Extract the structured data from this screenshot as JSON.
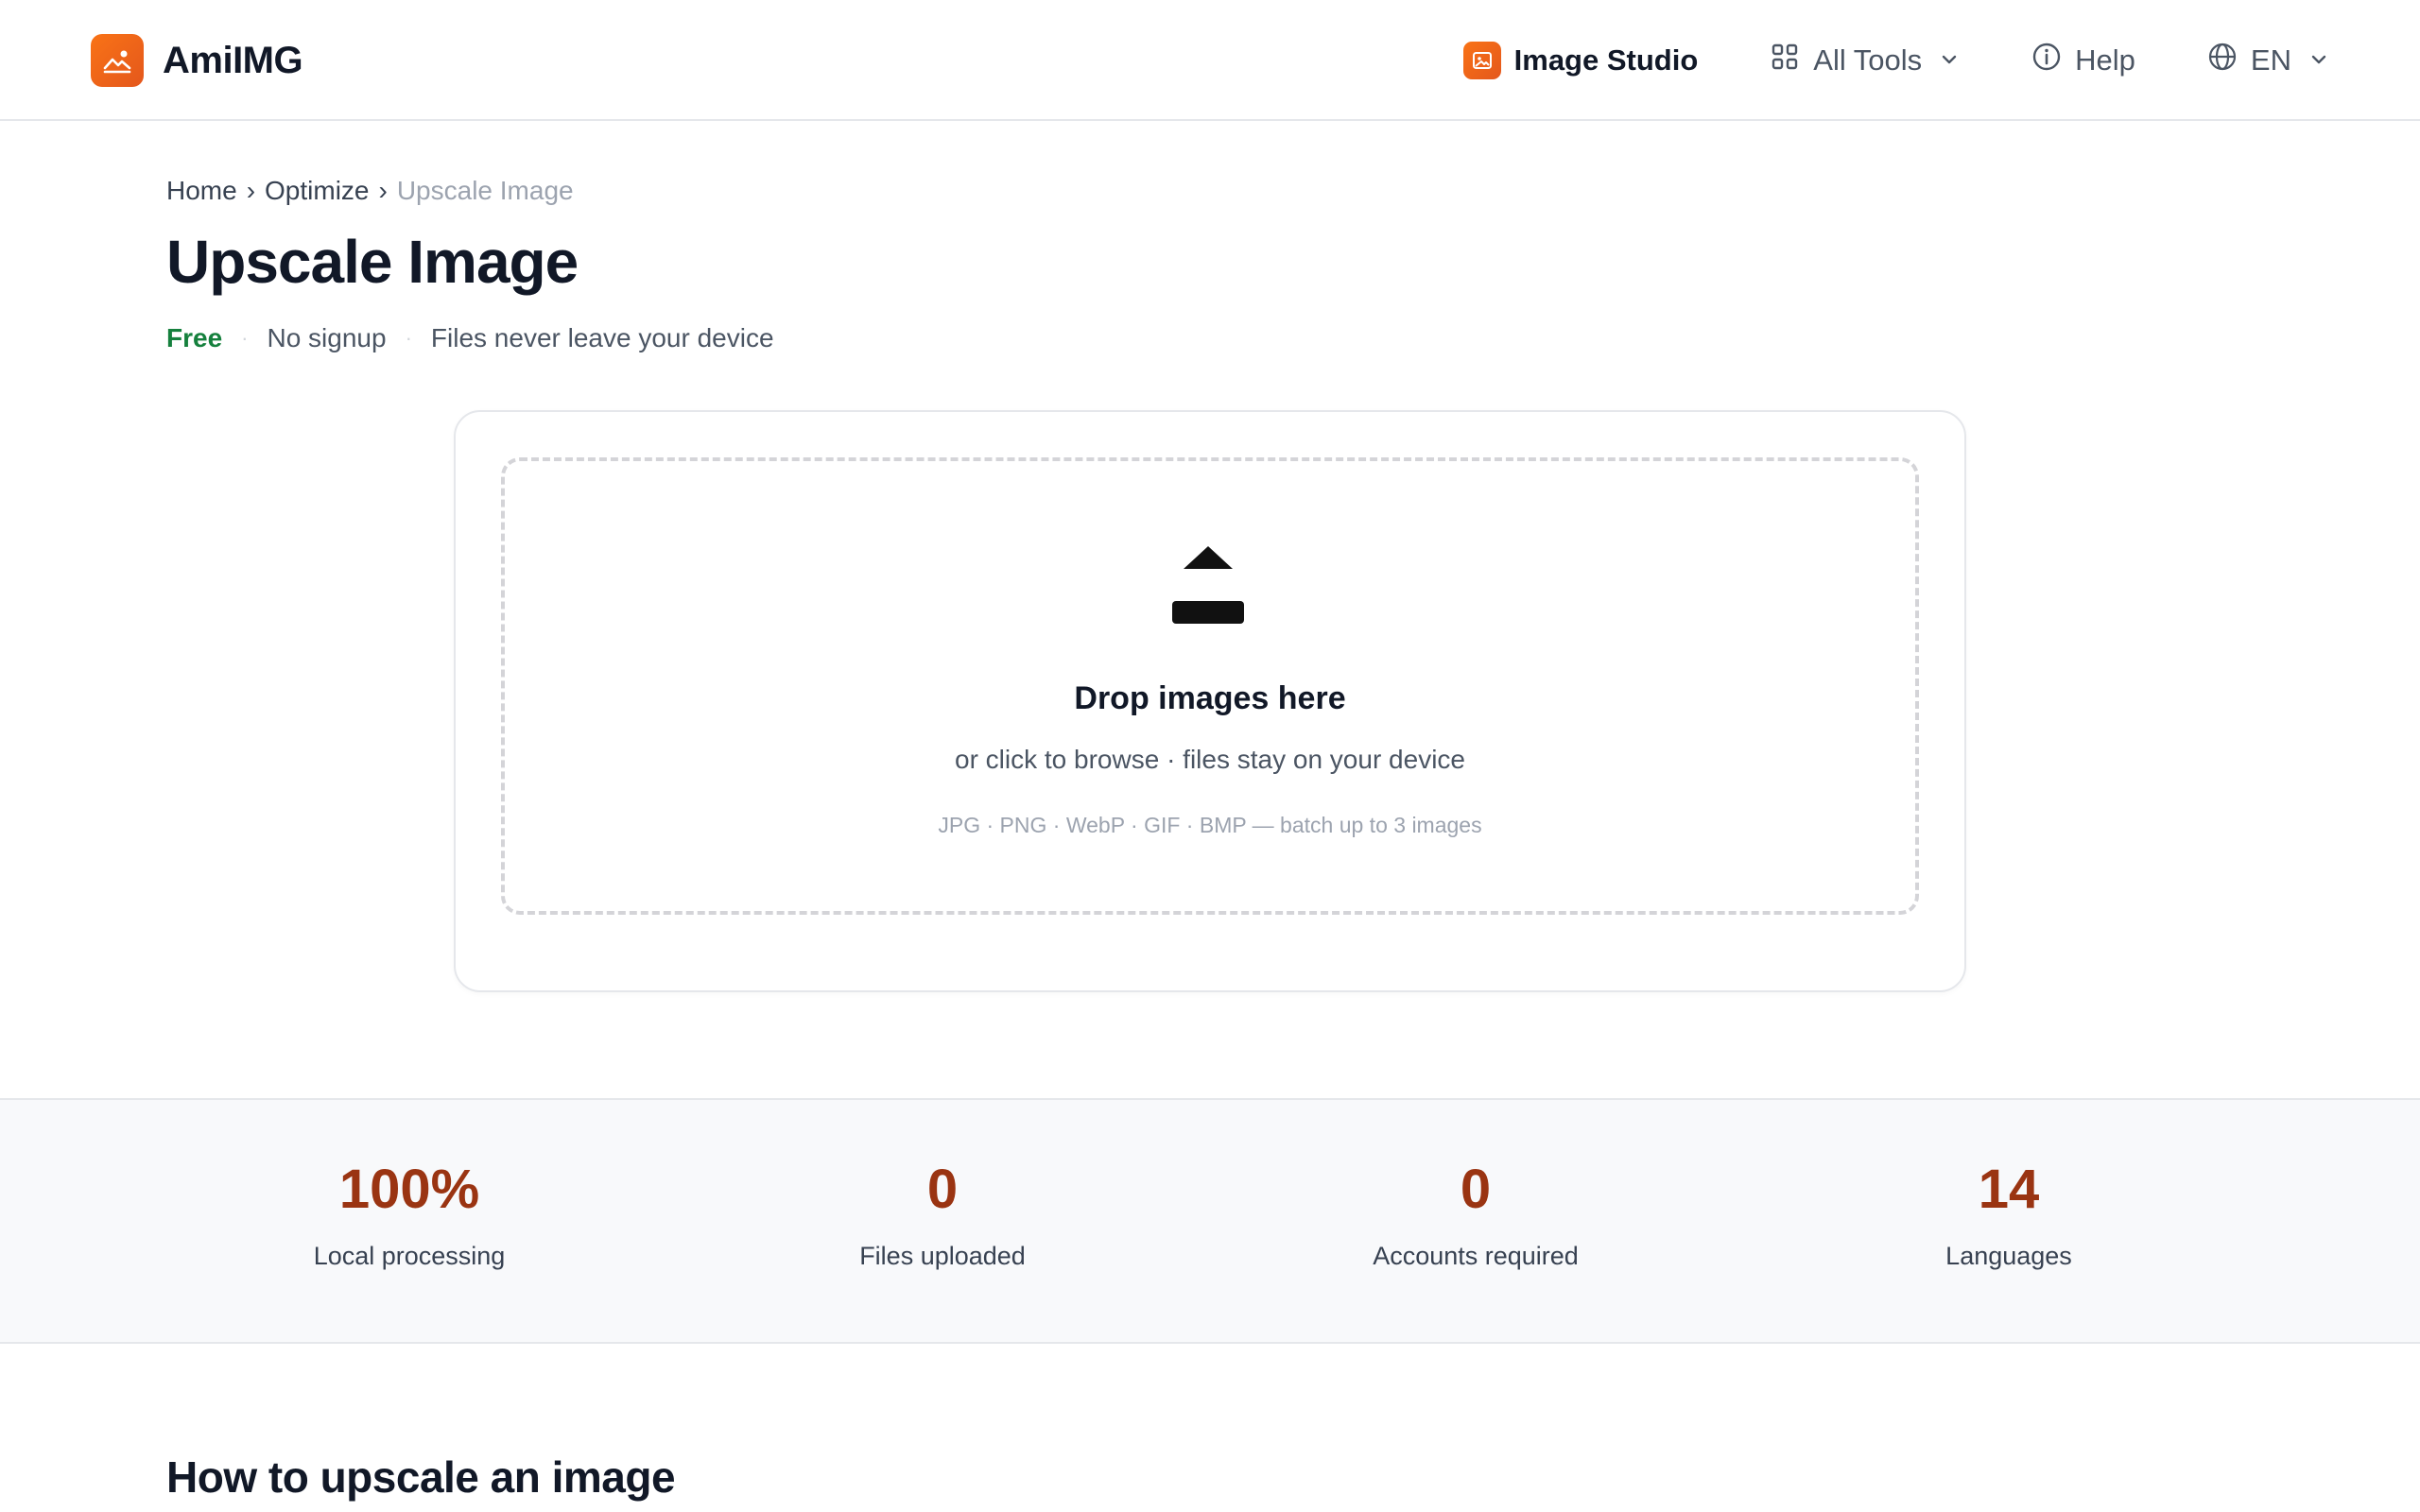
{
  "header": {
    "brand": "AmiIMG",
    "nav": {
      "studio": "Image Studio",
      "all_tools": "All Tools",
      "help": "Help",
      "lang": "EN"
    }
  },
  "breadcrumb": {
    "home": "Home",
    "sep": "›",
    "optimize": "Optimize",
    "current": "Upscale Image"
  },
  "page": {
    "title": "Upscale Image",
    "badges": {
      "free": "Free",
      "dot": "·",
      "no_signup": "No signup",
      "privacy": "Files never leave your device"
    }
  },
  "upload": {
    "title": "Drop images here",
    "subtitle": "or click to browse · files stay on your device",
    "formats": "JPG · PNG · WebP · GIF · BMP — batch up to 3 images"
  },
  "stats": [
    {
      "value": "100%",
      "label": "Local processing"
    },
    {
      "value": "0",
      "label": "Files uploaded"
    },
    {
      "value": "0",
      "label": "Accounts required"
    },
    {
      "value": "14",
      "label": "Languages"
    }
  ],
  "howto": {
    "title": "How to upscale an image"
  },
  "colors": {
    "brand": "#f97316",
    "free": "#15803d",
    "stat": "#9a3412"
  }
}
